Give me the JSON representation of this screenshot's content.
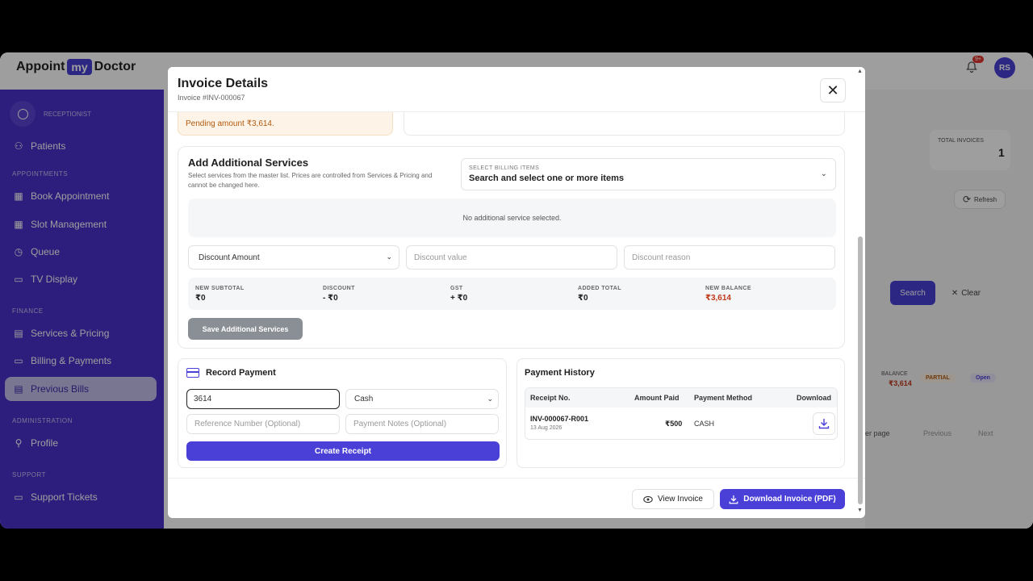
{
  "brand": {
    "part1": "Appoint",
    "part2": "my",
    "part3": "Doctor"
  },
  "header": {
    "notif_badge": "9+",
    "avatar_initials": "RS"
  },
  "sidebar": {
    "role": "RECEPTIONIST",
    "sections": {
      "appointments": "APPOINTMENTS",
      "finance": "FINANCE",
      "administration": "ADMINISTRATION",
      "support": "SUPPORT"
    },
    "items": {
      "patients": "Patients",
      "book": "Book Appointment",
      "slot": "Slot Management",
      "queue": "Queue",
      "tv": "TV Display",
      "services": "Services & Pricing",
      "billing": "Billing & Payments",
      "previous": "Previous Bills",
      "profile": "Profile",
      "support": "Support Tickets"
    }
  },
  "background": {
    "total_invoices_label": "TOTAL INVOICES",
    "total_invoices_value": "1",
    "refresh": "Refresh",
    "search": "Search",
    "clear": "Clear",
    "balance_label": "BALANCE",
    "balance_value": "₹3,614",
    "status_partial": "PARTIAL",
    "status_open": "Open",
    "per_page": "er page",
    "previous": "Previous",
    "next": "Next"
  },
  "modal": {
    "title": "Invoice Details",
    "subtitle": "Invoice #INV-000067",
    "pending_text": "Pending amount ₹3,614.",
    "add_services": {
      "title": "Add Additional Services",
      "description": "Select services from the master list. Prices are controlled from Services & Pricing and cannot be changed here.",
      "billing_label": "SELECT BILLING ITEMS",
      "billing_placeholder": "Search and select one or more items",
      "empty_text": "No additional service selected.",
      "discount_type": "Discount Amount",
      "discount_value_placeholder": "Discount value",
      "discount_reason_placeholder": "Discount reason",
      "totals": [
        {
          "label": "NEW SUBTOTAL",
          "value": "₹0"
        },
        {
          "label": "DISCOUNT",
          "value": "- ₹0"
        },
        {
          "label": "GST",
          "value": "+ ₹0"
        },
        {
          "label": "ADDED TOTAL",
          "value": "₹0"
        },
        {
          "label": "NEW BALANCE",
          "value": "₹3,614"
        }
      ],
      "save_label": "Save Additional Services"
    },
    "record_payment": {
      "title": "Record Payment",
      "amount_value": "3614",
      "method_value": "Cash",
      "reference_placeholder": "Reference Number (Optional)",
      "notes_placeholder": "Payment Notes (Optional)",
      "create_label": "Create Receipt"
    },
    "payment_history": {
      "title": "Payment History",
      "columns": [
        "Receipt No.",
        "Amount Paid",
        "Payment Method",
        "Download"
      ],
      "rows": [
        {
          "receipt": "INV-000067-R001",
          "date": "13 Aug 2026",
          "amount": "₹500",
          "method": "CASH"
        }
      ]
    },
    "footer": {
      "view_label": "View Invoice",
      "pdf_label": "Download Invoice (PDF)"
    }
  },
  "colors": {
    "accent": "#4a3fd6",
    "sidebar": "#4a2fc9",
    "danger": "#c0391b"
  }
}
